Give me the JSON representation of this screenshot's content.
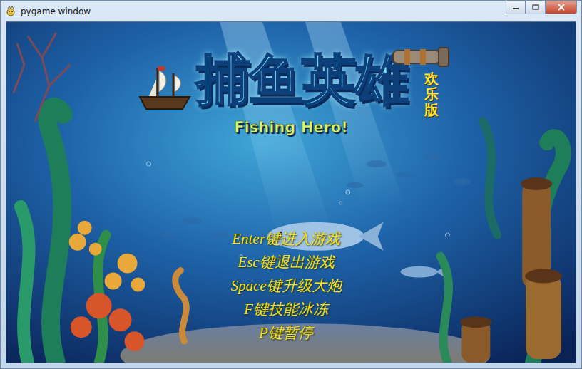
{
  "window": {
    "title": "pygame window"
  },
  "logo": {
    "title": "捕鱼英雄",
    "edition": "欢乐版",
    "subtitle": "Fishing Hero!"
  },
  "menu": [
    "Enter键进入游戏",
    "Esc键退出游戏",
    "Space键升级大炮",
    "F键技能冰冻",
    "P键暂停"
  ]
}
